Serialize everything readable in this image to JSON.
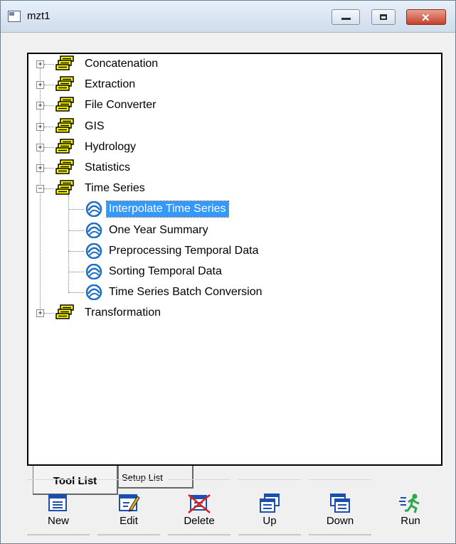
{
  "window": {
    "title": "mzt1",
    "close_glyph": "✕",
    "colors": {
      "selection": "#3399ff",
      "category_icon": "#ffff00",
      "tool_icon": "#1e6fc4"
    }
  },
  "tree": {
    "categories": [
      {
        "label": "Concatenation",
        "expander": "+"
      },
      {
        "label": "Extraction",
        "expander": "+"
      },
      {
        "label": "File Converter",
        "expander": "+"
      },
      {
        "label": "GIS",
        "expander": "+"
      },
      {
        "label": "Hydrology",
        "expander": "+"
      },
      {
        "label": "Statistics",
        "expander": "+"
      },
      {
        "label": "Time Series",
        "expander": "−"
      },
      {
        "label": "Transformation",
        "expander": "+"
      }
    ],
    "time_series_tools": [
      {
        "label": "Interpolate Time Series",
        "selected": true
      },
      {
        "label": "One Year Summary"
      },
      {
        "label": "Preprocessing Temporal Data"
      },
      {
        "label": "Sorting Temporal Data"
      },
      {
        "label": "Time Series Batch Conversion"
      }
    ]
  },
  "tabs": {
    "tool_list": "Tool List",
    "setup_list": "Setup List"
  },
  "toolbar": {
    "new": "New",
    "edit": "Edit",
    "delete": "Delete",
    "up": "Up",
    "down": "Down",
    "run": "Run"
  },
  "icons": [
    "app-icon",
    "minimize-icon",
    "maximize-icon",
    "close-icon",
    "database-icon",
    "tool-icon",
    "new-icon",
    "edit-icon",
    "delete-icon",
    "up-icon",
    "down-icon",
    "run-icon"
  ]
}
